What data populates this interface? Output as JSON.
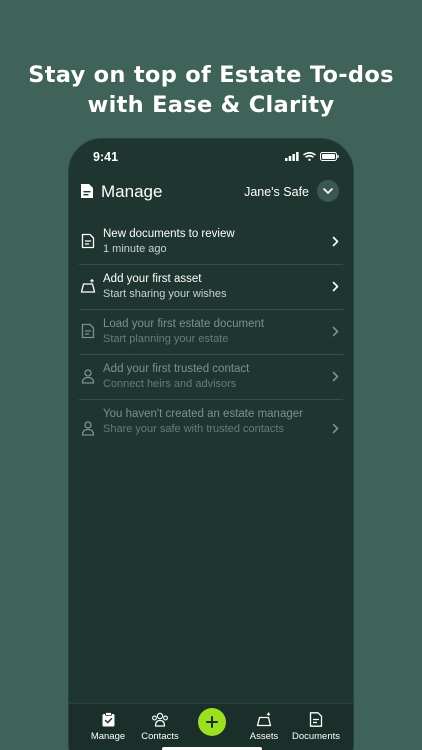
{
  "headline": {
    "line1": "Stay on top of Estate To-dos",
    "line2": "with Ease & Clarity"
  },
  "status_bar": {
    "time": "9:41"
  },
  "header": {
    "title": "Manage",
    "safe_name": "Jane's Safe"
  },
  "todos": [
    {
      "title": "New documents to review",
      "subtitle": "1 minute ago",
      "icon": "document-icon",
      "enabled": true
    },
    {
      "title": "Add your first asset",
      "subtitle": "Start sharing your wishes",
      "icon": "asset-icon",
      "enabled": true
    },
    {
      "title": "Load your first estate document",
      "subtitle": "Start planning your estate",
      "icon": "document-icon",
      "enabled": false
    },
    {
      "title": "Add your first trusted contact",
      "subtitle": "Connect heirs and advisors",
      "icon": "person-icon",
      "enabled": false
    },
    {
      "title": "You haven't created an estate manager",
      "subtitle": "Share your safe with trusted contacts",
      "icon": "person-icon",
      "enabled": false
    }
  ],
  "tabs": {
    "manage": "Manage",
    "contacts": "Contacts",
    "assets": "Assets",
    "documents": "Documents"
  },
  "colors": {
    "background": "#3f6359",
    "phone": "#1e3530",
    "accent": "#9be021"
  }
}
